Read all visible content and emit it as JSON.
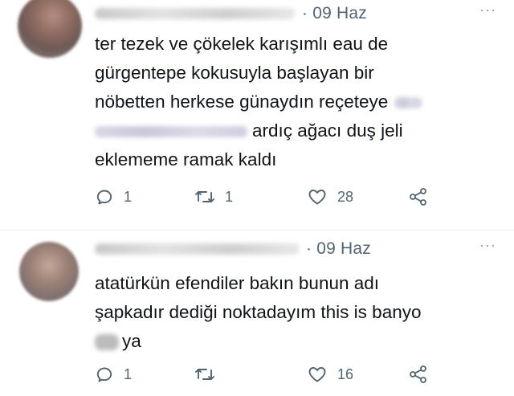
{
  "tweets": [
    {
      "date": "· 09 Haz",
      "more": "···",
      "first_line": "ter tezek ve çökelek karışımlı eau de",
      "line2": "gürgentepe kokusuyla başlayan bir",
      "line3": "nöbetten herkese günaydın reçeteye",
      "line4": "ardıç ağacı duş jeli",
      "line5": "eklememe ramak kaldı",
      "replies": "1",
      "retweets": "1",
      "likes": "28"
    },
    {
      "date": "· 09 Haz",
      "more": "···",
      "line1": "atatürkün efendiler bakın bunun adı",
      "line2": "şapkadır dediği noktadayım this is banyo",
      "line3": "ya",
      "replies": "1",
      "retweets": "",
      "likes": "16"
    }
  ],
  "icons": [
    "reply-icon",
    "retweet-icon",
    "like-icon",
    "share-icon",
    "more-icon"
  ],
  "colors": {
    "text": "#0f1419",
    "meta": "#536471",
    "divider": "#e6ecf0"
  }
}
